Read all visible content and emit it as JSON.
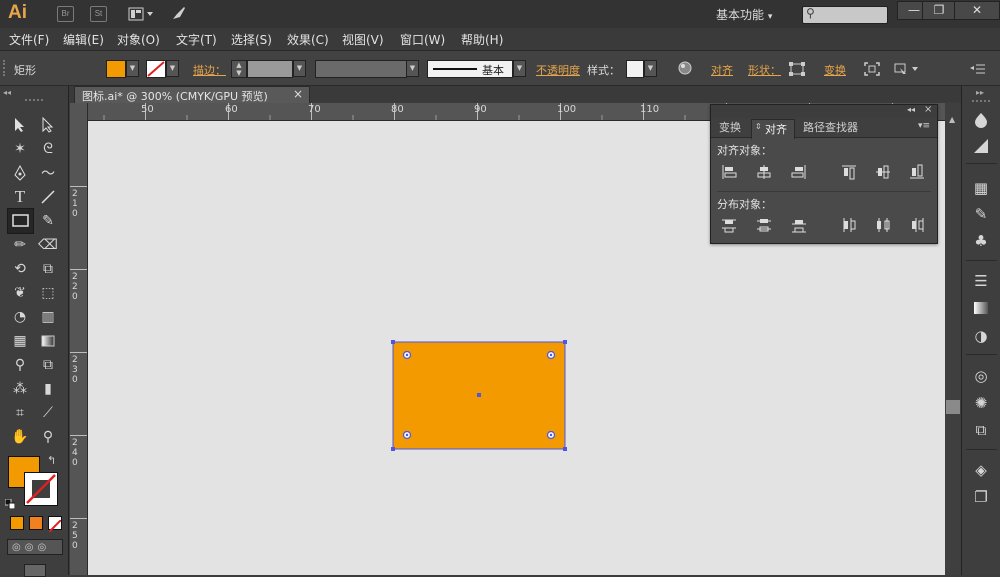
{
  "app": {
    "logo": "Ai",
    "icon_br": "Br",
    "icon_st": "St",
    "workspace": "基本功能"
  },
  "menu": [
    "文件(F)",
    "编辑(E)",
    "对象(O)",
    "文字(T)",
    "选择(S)",
    "效果(C)",
    "视图(V)",
    "窗口(W)",
    "帮助(H)"
  ],
  "control": {
    "object_type": "矩形",
    "stroke_label": "描边：",
    "stroke_style": "基本",
    "opacity_label": "不透明度",
    "style_label": "样式：",
    "align_label": "对齐",
    "shape_label": "形状：",
    "transform_label": "变换",
    "fill_color": "#f29a00"
  },
  "document": {
    "tab_title": "图标.ai* @ 300% (CMYK/GPU 预览)"
  },
  "rulers": {
    "h_ticks": [
      "50",
      "60",
      "70",
      "80",
      "90",
      "100",
      "110"
    ],
    "v_ticks": [
      "2 1 0",
      "2 2 0",
      "2 3 0",
      "2 4 0",
      "2 5 0"
    ]
  },
  "align_panel": {
    "tabs": [
      "变换",
      "对齐",
      "路径查找器"
    ],
    "active_tab": "对齐",
    "section_align": "对齐对象：",
    "section_distribute": "分布对象："
  },
  "colors": {
    "fill": "#f29a00",
    "selection": "#4f56e0",
    "canvas": "#e3e3e3",
    "accent": "#e8a64a"
  }
}
